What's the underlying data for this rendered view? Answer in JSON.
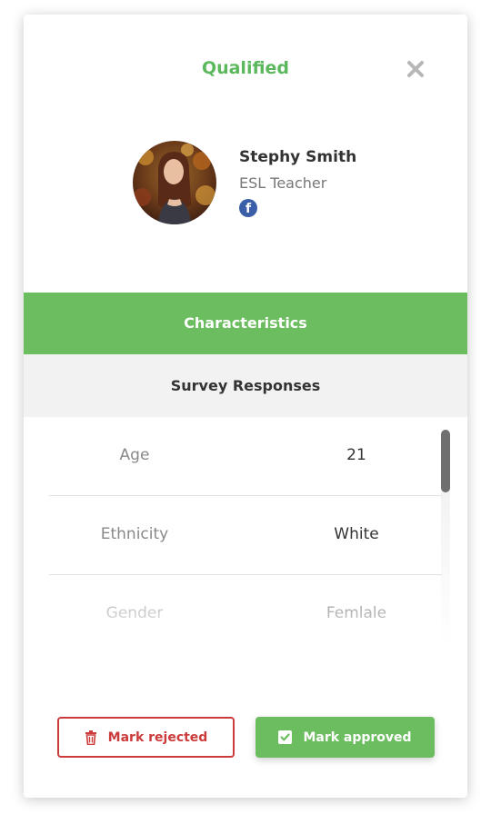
{
  "header": {
    "status": "Qualified"
  },
  "icons": {
    "close": "close-icon",
    "social": "facebook-icon",
    "reject": "trash-icon",
    "approve": "checkbox-icon"
  },
  "profile": {
    "name": "Stephy Smith",
    "role": "ESL Teacher",
    "facebook_glyph": "f"
  },
  "tabs": [
    {
      "label": "Characteristics",
      "active": true
    },
    {
      "label": "Survey Responses",
      "active": false
    }
  ],
  "responses": [
    {
      "label": "Age",
      "value": "21"
    },
    {
      "label": "Ethnicity",
      "value": "White"
    },
    {
      "label": "Gender",
      "value": "Femlale"
    }
  ],
  "actions": {
    "reject_label": "Mark rejected",
    "approve_label": "Mark approved"
  },
  "colors": {
    "accent_green": "#6cbd5f",
    "status_green": "#5cb85c",
    "reject_red": "#cc3b3b",
    "facebook_blue": "#3b5ea8"
  }
}
